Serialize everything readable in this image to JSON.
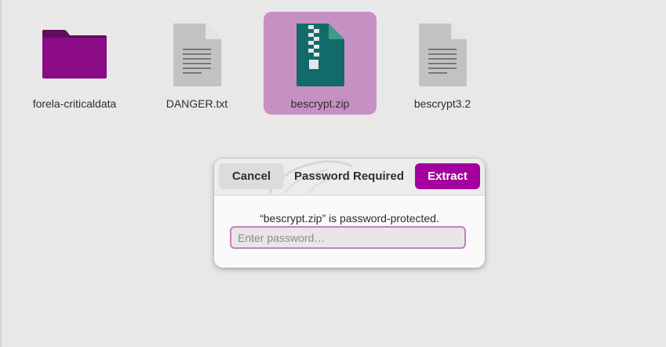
{
  "files": [
    {
      "name": "forela-criticaldata",
      "icon": "folder-icon",
      "selected": false
    },
    {
      "name": "DANGER.txt",
      "icon": "text-file-icon",
      "selected": false
    },
    {
      "name": "bescrypt.zip",
      "icon": "zip-archive-icon",
      "selected": true
    },
    {
      "name": "bescrypt3.2",
      "icon": "text-file-icon",
      "selected": false
    }
  ],
  "dialog": {
    "title": "Password Required",
    "cancel_label": "Cancel",
    "extract_label": "Extract",
    "message": "“bescrypt.zip” is password-protected.",
    "password_value": "",
    "password_placeholder": "Enter password…"
  },
  "colors": {
    "accent": "#a4009e",
    "selection": "#c790c3",
    "folder": "#8b0a86",
    "zip": "#136a6a",
    "background": "#e8e8e8"
  }
}
